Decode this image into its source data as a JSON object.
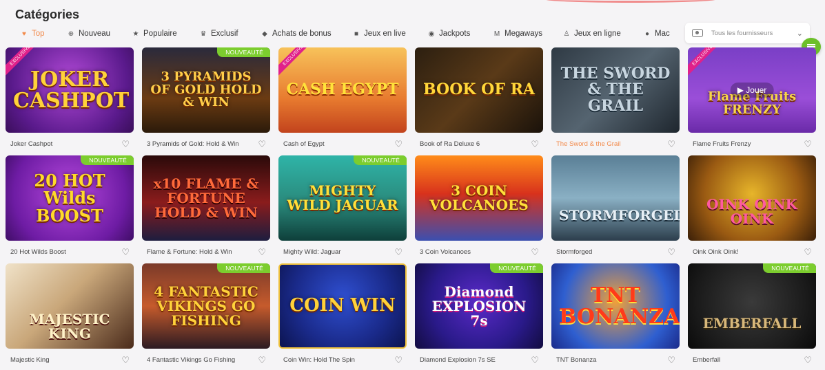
{
  "page": {
    "title": "Catégories"
  },
  "nav": {
    "items": [
      {
        "label": "Top",
        "icon": "heart-icon",
        "active": true
      },
      {
        "label": "Nouveau",
        "icon": "plus-circle-icon",
        "active": false
      },
      {
        "label": "Populaire",
        "icon": "star-icon",
        "active": false
      },
      {
        "label": "Exclusif",
        "icon": "crown-icon",
        "active": false
      },
      {
        "label": "Achats de bonus",
        "icon": "bonus-icon",
        "active": false
      },
      {
        "label": "Jeux en live",
        "icon": "camera-icon",
        "active": false
      },
      {
        "label": "Jackpots",
        "icon": "jackpot-icon",
        "active": false
      },
      {
        "label": "Megaways",
        "icon": "megaways-icon",
        "active": false
      },
      {
        "label": "Jeux en ligne",
        "icon": "person-icon",
        "active": false
      },
      {
        "label": "Mac",
        "icon": "tag-icon",
        "active": false
      }
    ]
  },
  "provider_filter": {
    "value": "Tous les fournisseurs",
    "icon": "gamepad-icon"
  },
  "badges": {
    "new": "NOUVEAUTÉ",
    "exclusive": "EXCLUSIVE"
  },
  "hover_play": "Jouer",
  "games": [
    {
      "name": "Joker Cashpot",
      "art": "JOKER CASHPOT",
      "badge": "exclusive",
      "highlight": false
    },
    {
      "name": "3 Pyramids of Gold: Hold & Win",
      "art": "3 PYRAMIDS OF GOLD HOLD & WIN",
      "badge": "new",
      "highlight": false
    },
    {
      "name": "Cash of Egypt",
      "art": "CASH EGYPT",
      "badge": "exclusive",
      "highlight": false
    },
    {
      "name": "Book of Ra Deluxe 6",
      "art": "BOOK OF RA",
      "badge": "",
      "highlight": false
    },
    {
      "name": "The Sword & the Grail",
      "art": "THE SWORD & THE GRAIL",
      "badge": "",
      "highlight": true
    },
    {
      "name": "Flame Fruits Frenzy",
      "art": "Flame Fruits FRENZY",
      "badge": "exclusive",
      "highlight": false,
      "hover": true
    },
    {
      "name": "20 Hot Wilds Boost",
      "art": "20 HOT Wilds BOOST",
      "badge": "new",
      "highlight": false
    },
    {
      "name": "Flame & Fortune: Hold & Win",
      "art": "x10 FLAME & FORTUNE HOLD & WIN",
      "badge": "",
      "highlight": false
    },
    {
      "name": "Mighty Wild: Jaguar",
      "art": "MIGHTY WILD JAGUAR",
      "badge": "new",
      "highlight": false
    },
    {
      "name": "3 Coin Volcanoes",
      "art": "3 COIN VOLCANOES",
      "badge": "",
      "highlight": false
    },
    {
      "name": "Stormforged",
      "art": "STORMFORGED",
      "badge": "",
      "highlight": false
    },
    {
      "name": "Oink Oink Oink!",
      "art": "OINK OINK OINK",
      "badge": "",
      "highlight": false
    },
    {
      "name": "Majestic King",
      "art": "MAJESTIC KING",
      "badge": "",
      "highlight": false
    },
    {
      "name": "4 Fantastic Vikings Go Fishing",
      "art": "4 FANTASTIC VIKINGS GO FISHING",
      "badge": "new",
      "highlight": false
    },
    {
      "name": "Coin Win: Hold The Spin",
      "art": "COIN WIN",
      "badge": "",
      "highlight": false
    },
    {
      "name": "Diamond Explosion 7s SE",
      "art": "Diamond EXPLOSION 7s",
      "badge": "new",
      "highlight": false
    },
    {
      "name": "TNT Bonanza",
      "art": "TNT BONANZA",
      "badge": "",
      "highlight": false
    },
    {
      "name": "Emberfall",
      "art": "EMBERFALL",
      "badge": "new",
      "highlight": false
    }
  ]
}
